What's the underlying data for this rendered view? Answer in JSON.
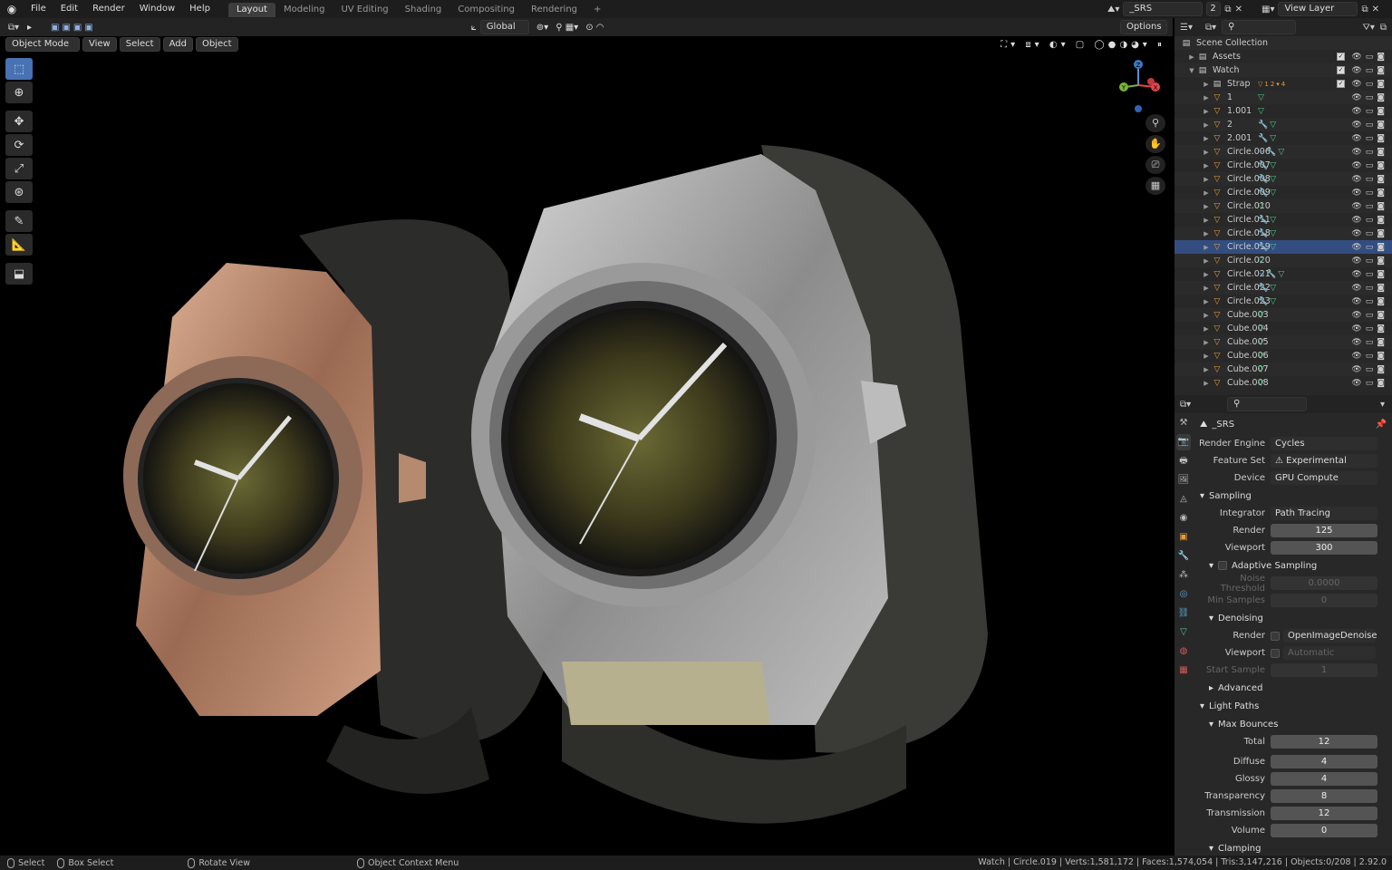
{
  "topbar": {
    "menus": [
      "File",
      "Edit",
      "Render",
      "Window",
      "Help"
    ],
    "workspaces": [
      "Layout",
      "Modeling",
      "UV Editing",
      "Shading",
      "Compositing",
      "Rendering"
    ],
    "active_workspace": "Layout",
    "add_tab": "+",
    "scene_name": "_SRS",
    "scene_users": "2",
    "view_layer": "View Layer"
  },
  "viewport": {
    "transform_orientation": "Global",
    "options": "Options",
    "mode": "Object Mode",
    "menus": [
      "View",
      "Select",
      "Add",
      "Object"
    ],
    "axes": {
      "z": "Z",
      "y": "Y",
      "x": "X"
    }
  },
  "outliner": {
    "root": "Scene Collection",
    "rows": [
      {
        "name": "Assets",
        "type": "collection",
        "mods": ""
      },
      {
        "name": "Watch",
        "type": "collection",
        "mods": ""
      },
      {
        "name": "Strap",
        "type": "collection",
        "mods": "12"
      },
      {
        "name": "1",
        "type": "mesh",
        "mods": "g"
      },
      {
        "name": "1.001",
        "type": "mesh",
        "mods": "g"
      },
      {
        "name": "2",
        "type": "mesh",
        "mods": "wg"
      },
      {
        "name": "2.001",
        "type": "mesh",
        "mods": "wg"
      },
      {
        "name": "Circle.006",
        "type": "mesh",
        "mods": "cwg"
      },
      {
        "name": "Circle.007",
        "type": "mesh",
        "mods": "wg"
      },
      {
        "name": "Circle.008",
        "type": "mesh",
        "mods": "wg"
      },
      {
        "name": "Circle.009",
        "type": "mesh",
        "mods": "wg"
      },
      {
        "name": "Circle.010",
        "type": "mesh",
        "mods": "g"
      },
      {
        "name": "Circle.011",
        "type": "mesh",
        "mods": "wg"
      },
      {
        "name": "Circle.018",
        "type": "mesh",
        "mods": "wg"
      },
      {
        "name": "Circle.019",
        "type": "mesh",
        "mods": "wg"
      },
      {
        "name": "Circle.020",
        "type": "mesh",
        "mods": "g"
      },
      {
        "name": "Circle.021",
        "type": "mesh",
        "mods": "cwg"
      },
      {
        "name": "Circle.022",
        "type": "mesh",
        "mods": "wg"
      },
      {
        "name": "Circle.023",
        "type": "mesh",
        "mods": "wg"
      },
      {
        "name": "Cube.003",
        "type": "mesh",
        "mods": "g"
      },
      {
        "name": "Cube.004",
        "type": "mesh",
        "mods": "g"
      },
      {
        "name": "Cube.005",
        "type": "mesh",
        "mods": "g"
      },
      {
        "name": "Cube.006",
        "type": "mesh",
        "mods": "g"
      },
      {
        "name": "Cube.007",
        "type": "mesh",
        "mods": "g"
      },
      {
        "name": "Cube.008",
        "type": "mesh",
        "mods": "g"
      }
    ]
  },
  "properties": {
    "scene": "_SRS",
    "render_engine": {
      "label": "Render Engine",
      "value": "Cycles"
    },
    "feature_set": {
      "label": "Feature Set",
      "value": "Experimental"
    },
    "device": {
      "label": "Device",
      "value": "GPU Compute"
    },
    "sampling": {
      "title": "Sampling",
      "integrator": {
        "label": "Integrator",
        "value": "Path Tracing"
      },
      "render": {
        "label": "Render",
        "value": "125"
      },
      "viewport": {
        "label": "Viewport",
        "value": "300"
      }
    },
    "adaptive": {
      "title": "Adaptive Sampling",
      "noise": {
        "label": "Noise Threshold",
        "value": "0.0000"
      },
      "min": {
        "label": "Min Samples",
        "value": "0"
      }
    },
    "denoising": {
      "title": "Denoising",
      "render": {
        "label": "Render",
        "value": "OpenImageDenoise"
      },
      "viewport": {
        "label": "Viewport",
        "value": "Automatic"
      },
      "start": {
        "label": "Start Sample",
        "value": "1"
      }
    },
    "advanced": "Advanced",
    "light_paths": {
      "title": "Light Paths",
      "max_bounces": "Max Bounces",
      "rows": [
        {
          "label": "Total",
          "value": "12"
        },
        {
          "label": "Diffuse",
          "value": "4"
        },
        {
          "label": "Glossy",
          "value": "4"
        },
        {
          "label": "Transparency",
          "value": "8"
        },
        {
          "label": "Transmission",
          "value": "12"
        },
        {
          "label": "Volume",
          "value": "0"
        }
      ]
    },
    "clamping": "Clamping"
  },
  "status": {
    "select": "Select",
    "box_select": "Box Select",
    "rotate": "Rotate View",
    "context": "Object Context Menu",
    "stats": "Watch | Circle.019 | Verts:1,581,172 | Faces:1,574,054 | Tris:3,147,216 | Objects:0/208 | 2.92.0"
  }
}
